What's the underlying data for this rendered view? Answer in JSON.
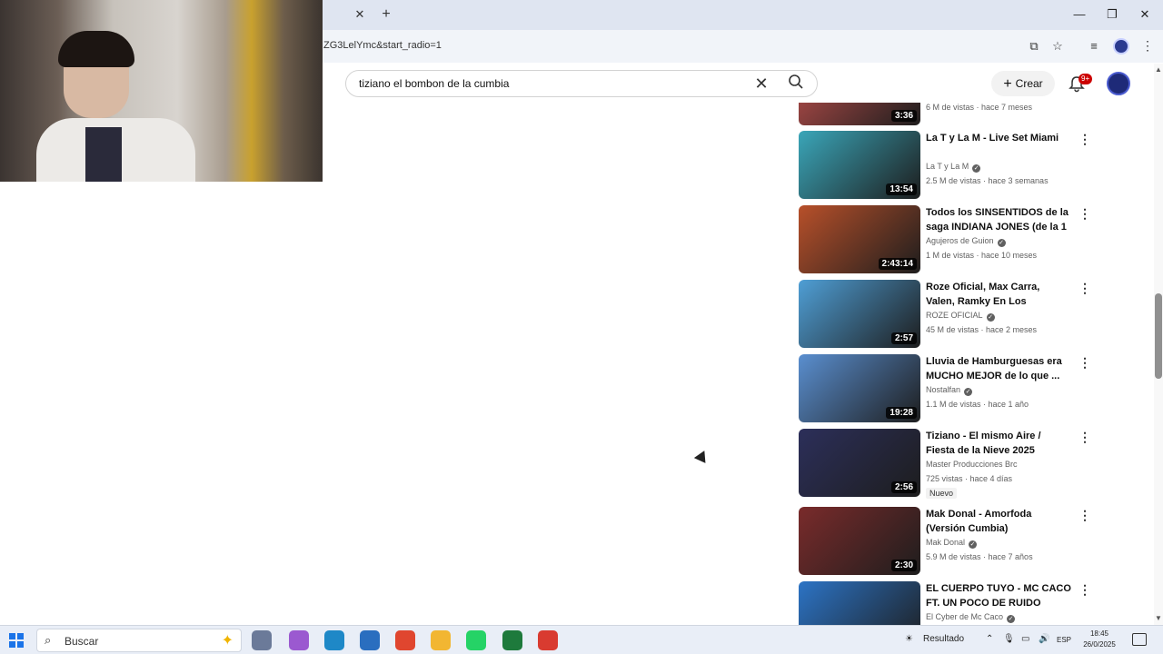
{
  "browser": {
    "url": "ZG3LelYmc&start_radio=1",
    "tab_close": "✕",
    "new_tab": "+",
    "window_controls": [
      "minimize-icon",
      "restore-icon",
      "close-icon"
    ]
  },
  "youtube": {
    "search_value": "tiziano el bombon de la cumbia",
    "create_label": "Crear",
    "notification_badge": "9+"
  },
  "videos": [
    {
      "title": "",
      "channel": "",
      "verified": false,
      "meta": "6 M de vistas · hace 7 meses",
      "duration": "3:36",
      "color": "#c0504d",
      "badge": ""
    },
    {
      "title": "La T y La M - Live Set Miami",
      "channel": "La T y La M",
      "verified": true,
      "meta": "2.5 M de vistas · hace 3 semanas",
      "duration": "13:54",
      "color": "#3aa6b9",
      "badge": ""
    },
    {
      "title": "Todos los SINSENTIDOS de la saga INDIANA JONES (de la 1 ...",
      "channel": "Agujeros de Guion",
      "verified": true,
      "meta": "1 M de vistas · hace 10 meses",
      "duration": "2:43:14",
      "color": "#b8502a",
      "badge": ""
    },
    {
      "title": "Roze Oficial, Max Carra, Valen, Ramky En Los Controles - Tu ...",
      "channel": "ROZE OFICIAL",
      "verified": true,
      "meta": "45 M de vistas · hace 2 meses",
      "duration": "2:57",
      "color": "#4f9fd6",
      "badge": ""
    },
    {
      "title": "Lluvia de Hamburguesas era MUCHO MEJOR de lo que ...",
      "channel": "Nostalfan",
      "verified": true,
      "meta": "1.1 M de vistas · hace 1 año",
      "duration": "19:28",
      "color": "#5a8fd0",
      "badge": ""
    },
    {
      "title": "Tiziano - El mismo Aire / Fiesta de la Nieve 2025",
      "channel": "Master Producciones Brc",
      "verified": false,
      "meta": "725 vistas · hace 4 días",
      "duration": "2:56",
      "color": "#2c2f5a",
      "badge": "Nuevo"
    },
    {
      "title": "Mak Donal - Amorfoda (Versión Cumbia)",
      "channel": "Mak Donal",
      "verified": true,
      "meta": "5.9 M de vistas · hace 7 años",
      "duration": "2:30",
      "color": "#7a2b2b",
      "badge": ""
    },
    {
      "title": "EL CUERPO TUYO - MC CACO FT. UN POCO DE RUIDO",
      "channel": "El Cyber de Mc Caco",
      "verified": true,
      "meta": "",
      "duration": "",
      "color": "#2c74c6",
      "badge": ""
    }
  ],
  "taskbar": {
    "search_label": "Buscar",
    "weather": "Resultado",
    "language": "ESP",
    "time": "18:45",
    "date": "26/0/2025",
    "apps": [
      {
        "name": "task-view-icon",
        "color": "#6b7a99"
      },
      {
        "name": "copilot-icon",
        "color": "#9b59d0"
      },
      {
        "name": "edge-icon",
        "color": "#1e88c7"
      },
      {
        "name": "store-icon",
        "color": "#2a6ebf"
      },
      {
        "name": "chrome-icon",
        "color": "#e0462f"
      },
      {
        "name": "explorer-icon",
        "color": "#f2b632"
      },
      {
        "name": "whatsapp-icon",
        "color": "#25d366"
      },
      {
        "name": "android-icon",
        "color": "#1e7a3c"
      },
      {
        "name": "chrome-profile-icon",
        "color": "#d93b30"
      }
    ]
  }
}
